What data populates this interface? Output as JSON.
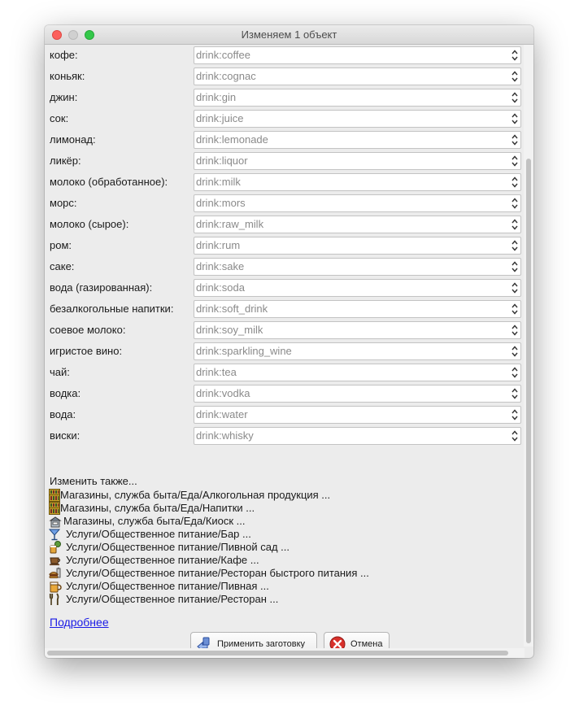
{
  "window": {
    "title": "Изменяем 1 объект"
  },
  "tags": [
    {
      "label": "кофе:",
      "value": "drink:coffee"
    },
    {
      "label": "коньяк:",
      "value": "drink:cognac"
    },
    {
      "label": "джин:",
      "value": "drink:gin"
    },
    {
      "label": "сок:",
      "value": "drink:juice"
    },
    {
      "label": "лимонад:",
      "value": "drink:lemonade"
    },
    {
      "label": "ликёр:",
      "value": "drink:liquor"
    },
    {
      "label": "молоко (обработанное):",
      "value": "drink:milk"
    },
    {
      "label": "морс:",
      "value": "drink:mors"
    },
    {
      "label": "молоко (сырое):",
      "value": "drink:raw_milk"
    },
    {
      "label": "ром:",
      "value": "drink:rum"
    },
    {
      "label": "саке:",
      "value": "drink:sake"
    },
    {
      "label": "вода (газированная):",
      "value": "drink:soda"
    },
    {
      "label": "безалкогольные напитки:",
      "value": "drink:soft_drink"
    },
    {
      "label": "соевое молоко:",
      "value": "drink:soy_milk"
    },
    {
      "label": "игристое вино:",
      "value": "drink:sparkling_wine"
    },
    {
      "label": "чай:",
      "value": "drink:tea"
    },
    {
      "label": "водка:",
      "value": "drink:vodka"
    },
    {
      "label": "вода:",
      "value": "drink:water"
    },
    {
      "label": "виски:",
      "value": "drink:whisky"
    }
  ],
  "also_change": {
    "title": "Изменить также...",
    "presets": [
      {
        "icon": "shelf-icon",
        "text": "Магазины, служба быта/Еда/Алкогольная продукция ..."
      },
      {
        "icon": "shelf-icon",
        "text": "Магазины, служба быта/Еда/Напитки ..."
      },
      {
        "icon": "kiosk-icon",
        "text": "Магазины, служба быта/Еда/Киоск ..."
      },
      {
        "icon": "cocktail-icon",
        "text": "Услуги/Общественное питание/Бар ..."
      },
      {
        "icon": "beer-garden-icon",
        "text": "Услуги/Общественное питание/Пивной сад ..."
      },
      {
        "icon": "coffee-cup-icon",
        "text": "Услуги/Общественное питание/Кафе ..."
      },
      {
        "icon": "fast-food-icon",
        "text": "Услуги/Общественное питание/Ресторан быстрого питания ..."
      },
      {
        "icon": "beer-mug-icon",
        "text": "Услуги/Общественное питание/Пивная ..."
      },
      {
        "icon": "fork-knife-icon",
        "text": "Услуги/Общественное питание/Ресторан ..."
      }
    ]
  },
  "more_link": "Подробнее",
  "buttons": {
    "apply": "Применить заготовку",
    "cancel": "Отмена"
  }
}
